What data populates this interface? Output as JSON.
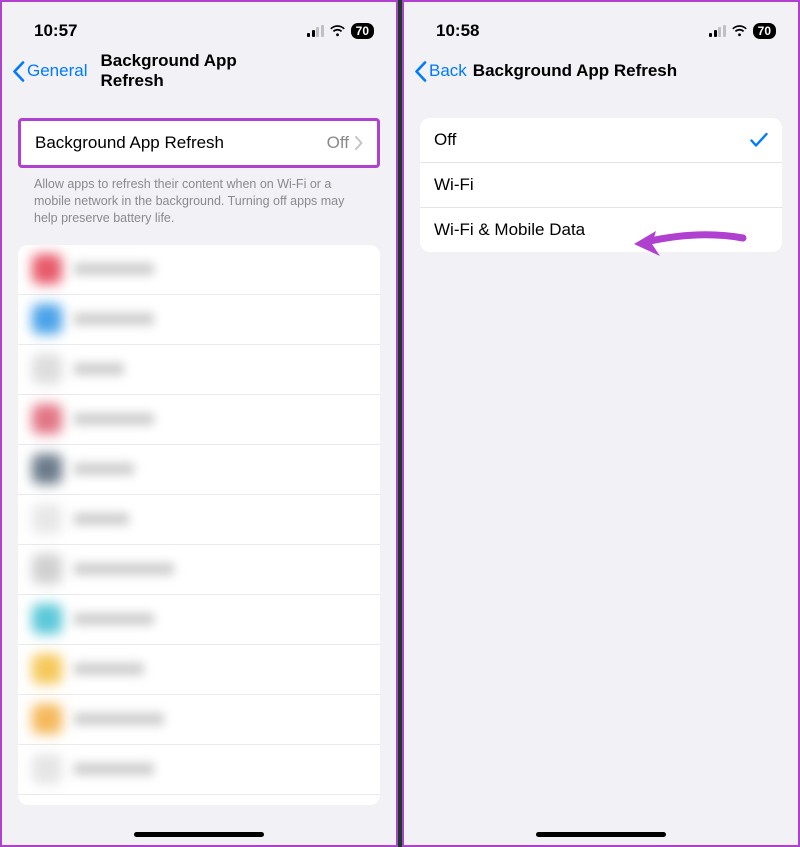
{
  "colors": {
    "accent": "#b040d0",
    "ios_blue": "#007aff",
    "secondary_text": "#8a8a8e"
  },
  "left": {
    "status": {
      "time": "10:57",
      "battery": "70"
    },
    "nav": {
      "back_label": "General",
      "title": "Background App Refresh"
    },
    "main_row": {
      "label": "Background App Refresh",
      "value": "Off"
    },
    "footer": "Allow apps to refresh their content when on Wi-Fi or a mobile network in the background. Turning off apps may help preserve battery life."
  },
  "right": {
    "status": {
      "time": "10:58",
      "battery": "70"
    },
    "nav": {
      "back_label": "Back",
      "title": "Background App Refresh"
    },
    "options": [
      {
        "label": "Off",
        "selected": true
      },
      {
        "label": "Wi-Fi",
        "selected": false
      },
      {
        "label": "Wi-Fi & Mobile Data",
        "selected": false
      }
    ]
  }
}
